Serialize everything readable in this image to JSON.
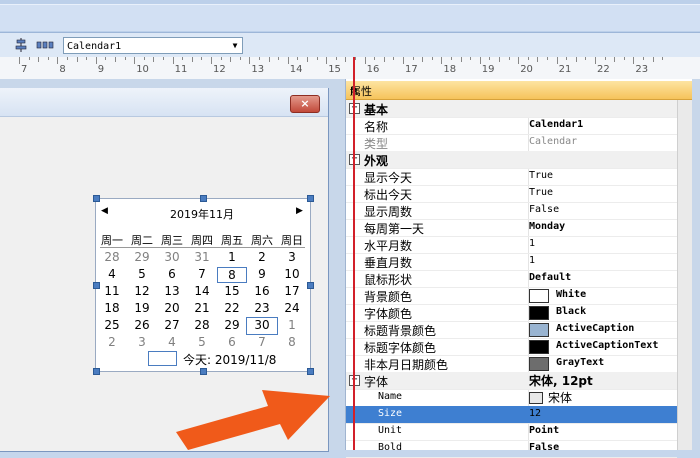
{
  "toolbar": {
    "control_combo": "Calendar1"
  },
  "ruler": {
    "numbers": [
      "7",
      "8",
      "9",
      "10",
      "11",
      "12",
      "13",
      "14",
      "15",
      "16",
      "17",
      "18",
      "19",
      "20",
      "21",
      "22",
      "23"
    ]
  },
  "form": {
    "close_glyph": "×"
  },
  "calendar": {
    "title": "2019年11月",
    "prev": "◀",
    "next": "▶",
    "weekdays": [
      "周一",
      "周二",
      "周三",
      "周四",
      "周五",
      "周六",
      "周日"
    ],
    "weeks": [
      [
        "28",
        "29",
        "30",
        "31",
        "1",
        "2",
        "3"
      ],
      [
        "4",
        "5",
        "6",
        "7",
        "8",
        "9",
        "10"
      ],
      [
        "11",
        "12",
        "13",
        "14",
        "15",
        "16",
        "17"
      ],
      [
        "18",
        "19",
        "20",
        "21",
        "22",
        "23",
        "24"
      ],
      [
        "25",
        "26",
        "27",
        "28",
        "29",
        "30",
        "1"
      ],
      [
        "2",
        "3",
        "4",
        "5",
        "6",
        "7",
        "8"
      ]
    ],
    "today_text": "今天: 2019/11/8"
  },
  "panel": {
    "title": "属性",
    "pin": "ᵽ",
    "rows": [
      {
        "kind": "cat",
        "label": "基本",
        "exp": "⊟"
      },
      {
        "kind": "prop",
        "name": "名称",
        "value": "Calendar1",
        "bold": true
      },
      {
        "kind": "prop",
        "name": "类型",
        "value": "Calendar",
        "gray": true
      },
      {
        "kind": "cat",
        "label": "外观",
        "exp": "⊟"
      },
      {
        "kind": "prop",
        "name": "显示今天",
        "value": "True"
      },
      {
        "kind": "prop",
        "name": "标出今天",
        "value": "True"
      },
      {
        "kind": "prop",
        "name": "显示周数",
        "value": "False"
      },
      {
        "kind": "prop",
        "name": "每周第一天",
        "value": "Monday",
        "bold": true
      },
      {
        "kind": "prop",
        "name": "水平月数",
        "value": "1"
      },
      {
        "kind": "prop",
        "name": "垂直月数",
        "value": "1"
      },
      {
        "kind": "prop",
        "name": "鼠标形状",
        "value": "Default",
        "bold": true
      },
      {
        "kind": "color",
        "name": "背景颜色",
        "value": "White",
        "swatch": "#ffffff"
      },
      {
        "kind": "color",
        "name": "字体颜色",
        "value": "Black",
        "swatch": "#000000"
      },
      {
        "kind": "color",
        "name": "标题背景颜色",
        "value": "ActiveCaption",
        "swatch": "#99b4d1"
      },
      {
        "kind": "color",
        "name": "标题字体颜色",
        "value": "ActiveCaptionText",
        "swatch": "#000000"
      },
      {
        "kind": "color",
        "name": "非本月日期颜色",
        "value": "GrayText",
        "swatch": "#6d6d6d"
      },
      {
        "kind": "catprop",
        "name": "字体",
        "value": "宋体, 12pt",
        "exp": "⊟"
      },
      {
        "kind": "sub",
        "name": "Name",
        "value": "宋体"
      },
      {
        "kind": "sub",
        "name": "Size",
        "value": "12",
        "highlight": true
      },
      {
        "kind": "sub",
        "name": "Unit",
        "value": "Point",
        "bold": true
      },
      {
        "kind": "sub",
        "name": "Bold",
        "value": "False",
        "bold": true
      }
    ]
  },
  "colors": {
    "accent": "#3e7fd1",
    "arrow": "#f05a1a",
    "panel_title": "#f6c35b",
    "ruler_marker": "#d2202a"
  },
  "icons": [
    "align-icon",
    "distribute-icon",
    "dropdown-arrow-icon",
    "close-icon",
    "pin-icon",
    "annotation-arrow"
  ]
}
